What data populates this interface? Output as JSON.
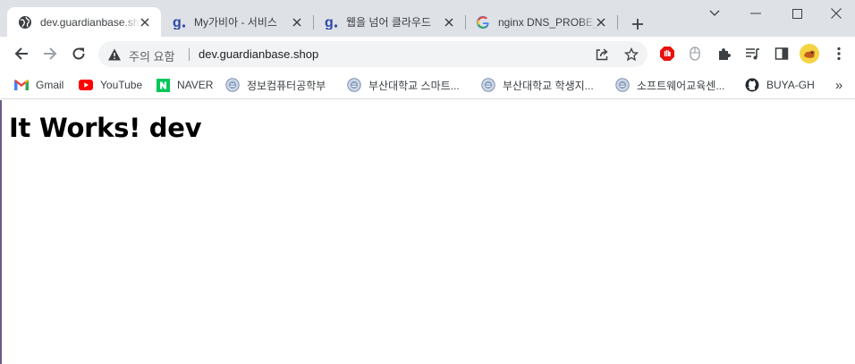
{
  "tabs": [
    {
      "title": "dev.guardianbase.shop",
      "favicon": "globe-icon",
      "active": true
    },
    {
      "title": "My가비아 - 서비스",
      "favicon": "gabia-icon",
      "active": false
    },
    {
      "title": "웹을 넘어 클라우드",
      "favicon": "gabia-icon",
      "active": false
    },
    {
      "title": "nginx DNS_PROBE_",
      "favicon": "google-icon",
      "active": false
    }
  ],
  "omnibox": {
    "security_label": "주의 요함",
    "url": "dev.guardianbase.shop"
  },
  "bookmarks": [
    {
      "label": "Gmail",
      "icon": "gmail-icon"
    },
    {
      "label": "YouTube",
      "icon": "youtube-icon"
    },
    {
      "label": "NAVER",
      "icon": "naver-icon"
    },
    {
      "label": "정보컴퓨터공학부",
      "icon": "university-seal-icon"
    },
    {
      "label": "부산대학교 스마트...",
      "icon": "university-seal-icon"
    },
    {
      "label": "부산대학교 학생지...",
      "icon": "university-seal-icon"
    },
    {
      "label": "소프트웨어교육센...",
      "icon": "university-seal-icon"
    },
    {
      "label": "BUYA-GH",
      "icon": "github-icon"
    }
  ],
  "bookmarks_overflow": "»",
  "page": {
    "heading": "It Works! dev"
  },
  "colors": {
    "tabstrip": "#dee1e6",
    "omnibox": "#f1f3f4",
    "gabia_blue": "#2e4aa8",
    "youtube_red": "#ff0000",
    "naver_green": "#03c75a"
  }
}
